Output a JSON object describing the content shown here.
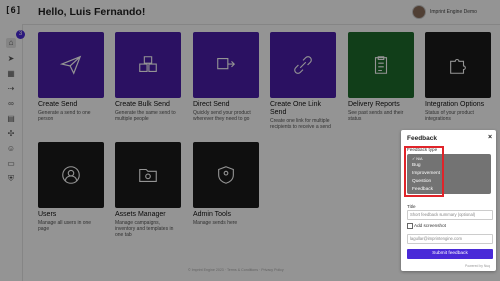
{
  "header": {
    "greeting": "Hello, Luis Fernando!",
    "org_name": "Imprint Engine Demo"
  },
  "brand": {
    "logo_text": "[6]"
  },
  "sidebar": {
    "badge": "3"
  },
  "tiles": [
    {
      "title": "Create Send",
      "desc": "Generate a send to one person",
      "color": "#4a1ea9"
    },
    {
      "title": "Create Bulk Send",
      "desc": "Generate the same send to multiple people",
      "color": "#4a1ea9"
    },
    {
      "title": "Direct Send",
      "desc": "Quickly send your product wherever they need to go",
      "color": "#4a1ea9"
    },
    {
      "title": "Create One Link Send",
      "desc": "Create one link for multiple recipients to receive a send",
      "color": "#4a1ea9"
    },
    {
      "title": "Delivery Reports",
      "desc": "See past sends and their status",
      "color": "#1e6b2c"
    },
    {
      "title": "Integration Options",
      "desc": "Status of your product integrations",
      "color": "#1a1a1a"
    },
    {
      "title": "Users",
      "desc": "Manage all users in one page",
      "color": "#1a1a1a"
    },
    {
      "title": "Assets Manager",
      "desc": "Manage campaigns, inventory and templates in one tab",
      "color": "#1a1a1a"
    },
    {
      "title": "Admin Tools",
      "desc": "Manage sends here",
      "color": "#1a1a1a"
    }
  ],
  "footer": {
    "text": "© Imprint Engine 2023 · Terms & Conditions · Privacy Policy"
  },
  "feedback": {
    "title": "Feedback",
    "close": "×",
    "type_label": "Feedback type",
    "options": [
      "✓ N/A",
      "Bug",
      "Improvement",
      "Question",
      "Feedback"
    ],
    "title_label": "Title",
    "title_placeholder": "Short feedback summary (optional)",
    "screenshot_label": "Add screenshot",
    "email_value": "lagullar@imprintengine.com",
    "submit": "Submit feedback",
    "powered": "Powered by Nuq"
  }
}
